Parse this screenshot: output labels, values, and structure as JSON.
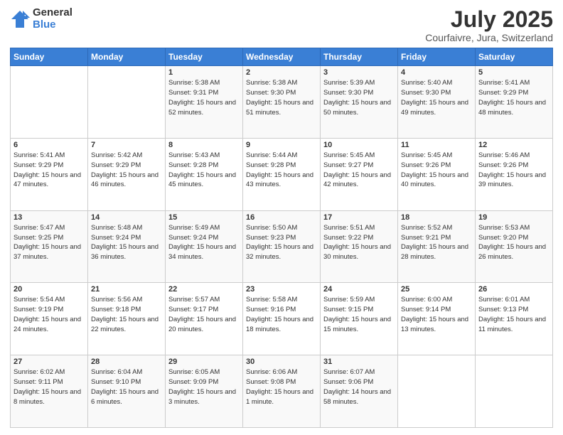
{
  "logo": {
    "general": "General",
    "blue": "Blue"
  },
  "title": "July 2025",
  "subtitle": "Courfaivre, Jura, Switzerland",
  "weekdays": [
    "Sunday",
    "Monday",
    "Tuesday",
    "Wednesday",
    "Thursday",
    "Friday",
    "Saturday"
  ],
  "weeks": [
    [
      {
        "day": "",
        "sunrise": "",
        "sunset": "",
        "daylight": ""
      },
      {
        "day": "",
        "sunrise": "",
        "sunset": "",
        "daylight": ""
      },
      {
        "day": "1",
        "sunrise": "Sunrise: 5:38 AM",
        "sunset": "Sunset: 9:31 PM",
        "daylight": "Daylight: 15 hours and 52 minutes."
      },
      {
        "day": "2",
        "sunrise": "Sunrise: 5:38 AM",
        "sunset": "Sunset: 9:30 PM",
        "daylight": "Daylight: 15 hours and 51 minutes."
      },
      {
        "day": "3",
        "sunrise": "Sunrise: 5:39 AM",
        "sunset": "Sunset: 9:30 PM",
        "daylight": "Daylight: 15 hours and 50 minutes."
      },
      {
        "day": "4",
        "sunrise": "Sunrise: 5:40 AM",
        "sunset": "Sunset: 9:30 PM",
        "daylight": "Daylight: 15 hours and 49 minutes."
      },
      {
        "day": "5",
        "sunrise": "Sunrise: 5:41 AM",
        "sunset": "Sunset: 9:29 PM",
        "daylight": "Daylight: 15 hours and 48 minutes."
      }
    ],
    [
      {
        "day": "6",
        "sunrise": "Sunrise: 5:41 AM",
        "sunset": "Sunset: 9:29 PM",
        "daylight": "Daylight: 15 hours and 47 minutes."
      },
      {
        "day": "7",
        "sunrise": "Sunrise: 5:42 AM",
        "sunset": "Sunset: 9:29 PM",
        "daylight": "Daylight: 15 hours and 46 minutes."
      },
      {
        "day": "8",
        "sunrise": "Sunrise: 5:43 AM",
        "sunset": "Sunset: 9:28 PM",
        "daylight": "Daylight: 15 hours and 45 minutes."
      },
      {
        "day": "9",
        "sunrise": "Sunrise: 5:44 AM",
        "sunset": "Sunset: 9:28 PM",
        "daylight": "Daylight: 15 hours and 43 minutes."
      },
      {
        "day": "10",
        "sunrise": "Sunrise: 5:45 AM",
        "sunset": "Sunset: 9:27 PM",
        "daylight": "Daylight: 15 hours and 42 minutes."
      },
      {
        "day": "11",
        "sunrise": "Sunrise: 5:45 AM",
        "sunset": "Sunset: 9:26 PM",
        "daylight": "Daylight: 15 hours and 40 minutes."
      },
      {
        "day": "12",
        "sunrise": "Sunrise: 5:46 AM",
        "sunset": "Sunset: 9:26 PM",
        "daylight": "Daylight: 15 hours and 39 minutes."
      }
    ],
    [
      {
        "day": "13",
        "sunrise": "Sunrise: 5:47 AM",
        "sunset": "Sunset: 9:25 PM",
        "daylight": "Daylight: 15 hours and 37 minutes."
      },
      {
        "day": "14",
        "sunrise": "Sunrise: 5:48 AM",
        "sunset": "Sunset: 9:24 PM",
        "daylight": "Daylight: 15 hours and 36 minutes."
      },
      {
        "day": "15",
        "sunrise": "Sunrise: 5:49 AM",
        "sunset": "Sunset: 9:24 PM",
        "daylight": "Daylight: 15 hours and 34 minutes."
      },
      {
        "day": "16",
        "sunrise": "Sunrise: 5:50 AM",
        "sunset": "Sunset: 9:23 PM",
        "daylight": "Daylight: 15 hours and 32 minutes."
      },
      {
        "day": "17",
        "sunrise": "Sunrise: 5:51 AM",
        "sunset": "Sunset: 9:22 PM",
        "daylight": "Daylight: 15 hours and 30 minutes."
      },
      {
        "day": "18",
        "sunrise": "Sunrise: 5:52 AM",
        "sunset": "Sunset: 9:21 PM",
        "daylight": "Daylight: 15 hours and 28 minutes."
      },
      {
        "day": "19",
        "sunrise": "Sunrise: 5:53 AM",
        "sunset": "Sunset: 9:20 PM",
        "daylight": "Daylight: 15 hours and 26 minutes."
      }
    ],
    [
      {
        "day": "20",
        "sunrise": "Sunrise: 5:54 AM",
        "sunset": "Sunset: 9:19 PM",
        "daylight": "Daylight: 15 hours and 24 minutes."
      },
      {
        "day": "21",
        "sunrise": "Sunrise: 5:56 AM",
        "sunset": "Sunset: 9:18 PM",
        "daylight": "Daylight: 15 hours and 22 minutes."
      },
      {
        "day": "22",
        "sunrise": "Sunrise: 5:57 AM",
        "sunset": "Sunset: 9:17 PM",
        "daylight": "Daylight: 15 hours and 20 minutes."
      },
      {
        "day": "23",
        "sunrise": "Sunrise: 5:58 AM",
        "sunset": "Sunset: 9:16 PM",
        "daylight": "Daylight: 15 hours and 18 minutes."
      },
      {
        "day": "24",
        "sunrise": "Sunrise: 5:59 AM",
        "sunset": "Sunset: 9:15 PM",
        "daylight": "Daylight: 15 hours and 15 minutes."
      },
      {
        "day": "25",
        "sunrise": "Sunrise: 6:00 AM",
        "sunset": "Sunset: 9:14 PM",
        "daylight": "Daylight: 15 hours and 13 minutes."
      },
      {
        "day": "26",
        "sunrise": "Sunrise: 6:01 AM",
        "sunset": "Sunset: 9:13 PM",
        "daylight": "Daylight: 15 hours and 11 minutes."
      }
    ],
    [
      {
        "day": "27",
        "sunrise": "Sunrise: 6:02 AM",
        "sunset": "Sunset: 9:11 PM",
        "daylight": "Daylight: 15 hours and 8 minutes."
      },
      {
        "day": "28",
        "sunrise": "Sunrise: 6:04 AM",
        "sunset": "Sunset: 9:10 PM",
        "daylight": "Daylight: 15 hours and 6 minutes."
      },
      {
        "day": "29",
        "sunrise": "Sunrise: 6:05 AM",
        "sunset": "Sunset: 9:09 PM",
        "daylight": "Daylight: 15 hours and 3 minutes."
      },
      {
        "day": "30",
        "sunrise": "Sunrise: 6:06 AM",
        "sunset": "Sunset: 9:08 PM",
        "daylight": "Daylight: 15 hours and 1 minute."
      },
      {
        "day": "31",
        "sunrise": "Sunrise: 6:07 AM",
        "sunset": "Sunset: 9:06 PM",
        "daylight": "Daylight: 14 hours and 58 minutes."
      },
      {
        "day": "",
        "sunrise": "",
        "sunset": "",
        "daylight": ""
      },
      {
        "day": "",
        "sunrise": "",
        "sunset": "",
        "daylight": ""
      }
    ]
  ]
}
